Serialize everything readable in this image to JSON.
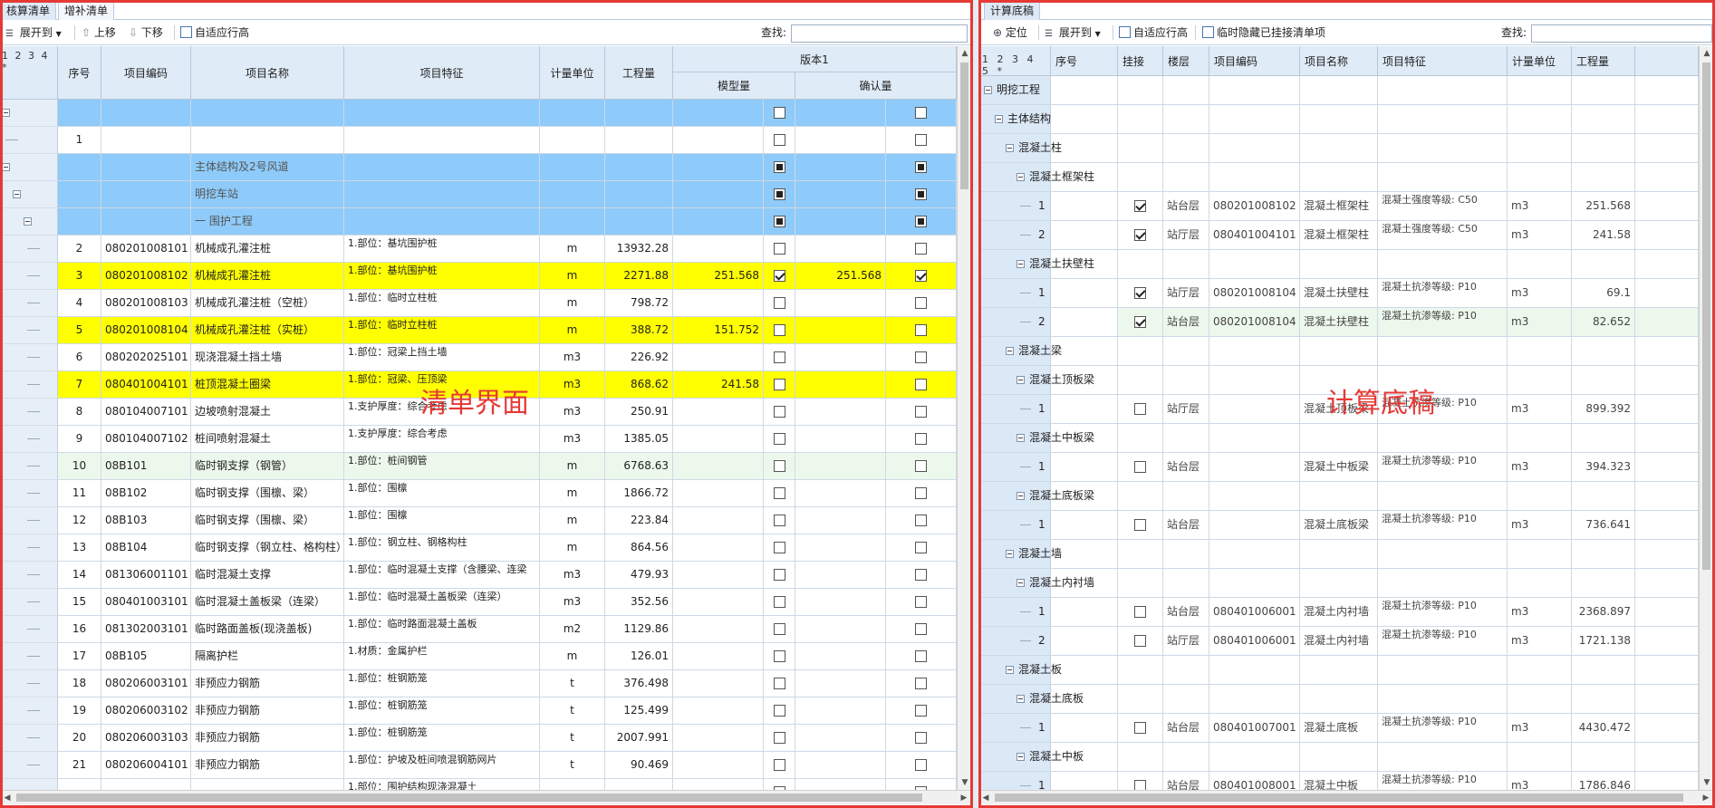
{
  "colors": {
    "accent_blue": "#8ecbfa",
    "highlight_yellow": "#ffff00",
    "pale_green": "#edf8ed",
    "frame_red": "#e53935"
  },
  "left": {
    "tabs": [
      "核算清单",
      "增补清单"
    ],
    "toolbar": {
      "expand_label": "展开到",
      "up_label": "上移",
      "down_label": "下移",
      "auto_height_label": "自适应行高",
      "search_label": "查找:"
    },
    "levels": "1 2 3 4 *",
    "headers": {
      "seq": "序号",
      "code": "项目编码",
      "name": "项目名称",
      "feature": "项目特征",
      "unit": "计量单位",
      "qty": "工程量",
      "version": "版本1",
      "model_qty": "模型量",
      "confirm_qty": "确认量"
    },
    "overlay": "清单界面",
    "rows": [
      {
        "seq": "",
        "code": "",
        "name": "",
        "feature": "",
        "unit": "",
        "qty": "",
        "model": "",
        "c1": "off",
        "confirm": "",
        "c2": "off",
        "style": "blue"
      },
      {
        "seq": "1",
        "code": "",
        "name": "",
        "feature": "",
        "unit": "",
        "qty": "",
        "model": "",
        "c1": "off",
        "confirm": "",
        "c2": "off",
        "style": "white"
      },
      {
        "seq": "",
        "code": "",
        "name": "主体结构及2号风道",
        "feature": "",
        "unit": "",
        "qty": "",
        "model": "",
        "c1": "part",
        "confirm": "",
        "c2": "part",
        "style": "blue"
      },
      {
        "seq": "",
        "code": "",
        "name": "明挖车站",
        "feature": "",
        "unit": "",
        "qty": "",
        "model": "",
        "c1": "part",
        "confirm": "",
        "c2": "part",
        "style": "blue"
      },
      {
        "seq": "",
        "code": "",
        "name": "一 围护工程",
        "feature": "",
        "unit": "",
        "qty": "",
        "model": "",
        "c1": "part",
        "confirm": "",
        "c2": "part",
        "style": "blue"
      },
      {
        "seq": "2",
        "code": "080201008101",
        "name": "机械成孔灌注桩",
        "feature": "1.部位：基坑围护桩",
        "unit": "m",
        "qty": "13932.28",
        "model": "",
        "c1": "off",
        "confirm": "",
        "c2": "off",
        "style": "white"
      },
      {
        "seq": "3",
        "code": "080201008102",
        "name": "机械成孔灌注桩",
        "feature": "1.部位：基坑围护桩",
        "unit": "m",
        "qty": "2271.88",
        "model": "251.568",
        "c1": "on",
        "confirm": "251.568",
        "c2": "on",
        "style": "yellow"
      },
      {
        "seq": "4",
        "code": "080201008103",
        "name": "机械成孔灌注桩（空桩）",
        "feature": "1.部位：临时立柱桩",
        "unit": "m",
        "qty": "798.72",
        "model": "",
        "c1": "off",
        "confirm": "",
        "c2": "off",
        "style": "white"
      },
      {
        "seq": "5",
        "code": "080201008104",
        "name": "机械成孔灌注桩（实桩）",
        "feature": "1.部位：临时立柱桩",
        "unit": "m",
        "qty": "388.72",
        "model": "151.752",
        "c1": "off",
        "confirm": "",
        "c2": "off",
        "style": "yellow"
      },
      {
        "seq": "6",
        "code": "080202025101",
        "name": "现浇混凝土挡土墙",
        "feature": "1.部位：冠梁上挡土墙",
        "unit": "m3",
        "qty": "226.92",
        "model": "",
        "c1": "off",
        "confirm": "",
        "c2": "off",
        "style": "white"
      },
      {
        "seq": "7",
        "code": "080401004101",
        "name": "桩顶混凝土圈梁",
        "feature": "1.部位：冠梁、压顶梁",
        "unit": "m3",
        "qty": "868.62",
        "model": "241.58",
        "c1": "off",
        "confirm": "",
        "c2": "off",
        "style": "yellow"
      },
      {
        "seq": "8",
        "code": "080104007101",
        "name": "边坡喷射混凝土",
        "feature": "1.支护厚度：综合考虑",
        "unit": "m3",
        "qty": "250.91",
        "model": "",
        "c1": "off",
        "confirm": "",
        "c2": "off",
        "style": "white"
      },
      {
        "seq": "9",
        "code": "080104007102",
        "name": "桩间喷射混凝土",
        "feature": "1.支护厚度：综合考虑",
        "unit": "m3",
        "qty": "1385.05",
        "model": "",
        "c1": "off",
        "confirm": "",
        "c2": "off",
        "style": "white"
      },
      {
        "seq": "10",
        "code": "08B101",
        "name": "临时钢支撑（钢管）",
        "feature": "1.部位：桩间钢管",
        "unit": "m",
        "qty": "6768.63",
        "model": "",
        "c1": "off",
        "confirm": "",
        "c2": "off",
        "style": "green"
      },
      {
        "seq": "11",
        "code": "08B102",
        "name": "临时钢支撑（围檩、梁）",
        "feature": "1.部位：围檩",
        "unit": "m",
        "qty": "1866.72",
        "model": "",
        "c1": "off",
        "confirm": "",
        "c2": "off",
        "style": "white"
      },
      {
        "seq": "12",
        "code": "08B103",
        "name": "临时钢支撑（围檩、梁）",
        "feature": "1.部位：围檩",
        "unit": "m",
        "qty": "223.84",
        "model": "",
        "c1": "off",
        "confirm": "",
        "c2": "off",
        "style": "white"
      },
      {
        "seq": "13",
        "code": "08B104",
        "name": "临时钢支撑（钢立柱、格构柱）",
        "feature": "1.部位：钢立柱、钢格构柱",
        "unit": "m",
        "qty": "864.56",
        "model": "",
        "c1": "off",
        "confirm": "",
        "c2": "off",
        "style": "white"
      },
      {
        "seq": "14",
        "code": "081306001101",
        "name": "临时混凝土支撑",
        "feature": "1.部位：临时混凝土支撑（含腰梁、连梁",
        "unit": "m3",
        "qty": "479.93",
        "model": "",
        "c1": "off",
        "confirm": "",
        "c2": "off",
        "style": "white"
      },
      {
        "seq": "15",
        "code": "080401003101",
        "name": "临时混凝土盖板梁（连梁）",
        "feature": "1.部位：临时混凝土盖板梁（连梁）",
        "unit": "m3",
        "qty": "352.56",
        "model": "",
        "c1": "off",
        "confirm": "",
        "c2": "off",
        "style": "white"
      },
      {
        "seq": "16",
        "code": "081302003101",
        "name": "临时路面盖板(现浇盖板)",
        "feature": "1.部位：临时路面混凝土盖板",
        "unit": "m2",
        "qty": "1129.86",
        "model": "",
        "c1": "off",
        "confirm": "",
        "c2": "off",
        "style": "white"
      },
      {
        "seq": "17",
        "code": "08B105",
        "name": "隔离护栏",
        "feature": "1.材质：金属护栏",
        "unit": "m",
        "qty": "126.01",
        "model": "",
        "c1": "off",
        "confirm": "",
        "c2": "off",
        "style": "white"
      },
      {
        "seq": "18",
        "code": "080206003101",
        "name": "非预应力钢筋",
        "feature": "1.部位：桩钢筋笼",
        "unit": "t",
        "qty": "376.498",
        "model": "",
        "c1": "off",
        "confirm": "",
        "c2": "off",
        "style": "white"
      },
      {
        "seq": "19",
        "code": "080206003102",
        "name": "非预应力钢筋",
        "feature": "1.部位：桩钢筋笼",
        "unit": "t",
        "qty": "125.499",
        "model": "",
        "c1": "off",
        "confirm": "",
        "c2": "off",
        "style": "white"
      },
      {
        "seq": "20",
        "code": "080206003103",
        "name": "非预应力钢筋",
        "feature": "1.部位：桩钢筋笼",
        "unit": "t",
        "qty": "2007.991",
        "model": "",
        "c1": "off",
        "confirm": "",
        "c2": "off",
        "style": "white"
      },
      {
        "seq": "21",
        "code": "080206004101",
        "name": "非预应力钢筋",
        "feature": "1.部位：护坡及桩间喷混钢筋网片",
        "unit": "t",
        "qty": "90.469",
        "model": "",
        "c1": "off",
        "confirm": "",
        "c2": "off",
        "style": "white"
      },
      {
        "seq": "",
        "code": "",
        "name": "",
        "feature": "1.部位：围护结构现浇混凝土",
        "unit": "",
        "qty": "",
        "model": "",
        "c1": "off",
        "confirm": "",
        "c2": "off",
        "style": "white"
      }
    ]
  },
  "right": {
    "tabs": [
      "计算底稿"
    ],
    "toolbar": {
      "locate_label": "定位",
      "expand_label": "展开到",
      "auto_height_label": "自适应行高",
      "hide_label": "临时隐藏已挂接清单项",
      "search_label": "查找:"
    },
    "levels": "1 2 3 4 5 *",
    "headers": {
      "seq": "序号",
      "attach": "挂接",
      "floor": "楼层",
      "code": "项目编码",
      "name": "项目名称",
      "feature": "项目特征",
      "unit": "计量单位",
      "qty": "工程量"
    },
    "overlay": "计算底稿",
    "rows": [
      {
        "type": "group",
        "depth": 0,
        "label": "明挖工程"
      },
      {
        "type": "group",
        "depth": 1,
        "label": "主体结构"
      },
      {
        "type": "group",
        "depth": 2,
        "label": "混凝土柱"
      },
      {
        "type": "group",
        "depth": 3,
        "label": "混凝土框架柱"
      },
      {
        "type": "item",
        "depth": 4,
        "seq": "1",
        "chk": "on",
        "floor": "站台层",
        "code": "080201008102",
        "name": "混凝土框架柱",
        "feature": "混凝土强度等级: C50",
        "unit": "m3",
        "qty": "251.568",
        "style": "white"
      },
      {
        "type": "item",
        "depth": 4,
        "seq": "2",
        "chk": "on",
        "floor": "站厅层",
        "code": "080401004101",
        "name": "混凝土框架柱",
        "feature": "混凝土强度等级: C50",
        "unit": "m3",
        "qty": "241.58",
        "style": "white"
      },
      {
        "type": "group",
        "depth": 3,
        "label": "混凝土扶壁柱"
      },
      {
        "type": "item",
        "depth": 4,
        "seq": "1",
        "chk": "on",
        "floor": "站厅层",
        "code": "080201008104",
        "name": "混凝土扶壁柱",
        "feature": "混凝土抗渗等级: P10",
        "unit": "m3",
        "qty": "69.1",
        "style": "white"
      },
      {
        "type": "item",
        "depth": 4,
        "seq": "2",
        "chk": "on",
        "floor": "站台层",
        "code": "080201008104",
        "name": "混凝土扶壁柱",
        "feature": "混凝土抗渗等级: P10",
        "unit": "m3",
        "qty": "82.652",
        "style": "green"
      },
      {
        "type": "group",
        "depth": 2,
        "label": "混凝土梁"
      },
      {
        "type": "group",
        "depth": 3,
        "label": "混凝土顶板梁"
      },
      {
        "type": "item",
        "depth": 4,
        "seq": "1",
        "chk": "off",
        "floor": "站厅层",
        "code": "",
        "name": "混凝土顶板梁",
        "feature": "混凝土抗渗等级: P10",
        "unit": "m3",
        "qty": "899.392",
        "style": "white"
      },
      {
        "type": "group",
        "depth": 3,
        "label": "混凝土中板梁"
      },
      {
        "type": "item",
        "depth": 4,
        "seq": "1",
        "chk": "off",
        "floor": "站台层",
        "code": "",
        "name": "混凝土中板梁",
        "feature": "混凝土抗渗等级: P10",
        "unit": "m3",
        "qty": "394.323",
        "style": "white"
      },
      {
        "type": "group",
        "depth": 3,
        "label": "混凝土底板梁"
      },
      {
        "type": "item",
        "depth": 4,
        "seq": "1",
        "chk": "off",
        "floor": "站台层",
        "code": "",
        "name": "混凝土底板梁",
        "feature": "混凝土抗渗等级: P10",
        "unit": "m3",
        "qty": "736.641",
        "style": "white"
      },
      {
        "type": "group",
        "depth": 2,
        "label": "混凝土墙"
      },
      {
        "type": "group",
        "depth": 3,
        "label": "混凝土内衬墙"
      },
      {
        "type": "item",
        "depth": 4,
        "seq": "1",
        "chk": "off",
        "floor": "站台层",
        "code": "080401006001",
        "name": "混凝土内衬墙",
        "feature": "混凝土抗渗等级: P10",
        "unit": "m3",
        "qty": "2368.897",
        "style": "white"
      },
      {
        "type": "item",
        "depth": 4,
        "seq": "2",
        "chk": "off",
        "floor": "站厅层",
        "code": "080401006001",
        "name": "混凝土内衬墙",
        "feature": "混凝土抗渗等级: P10",
        "unit": "m3",
        "qty": "1721.138",
        "style": "white"
      },
      {
        "type": "group",
        "depth": 2,
        "label": "混凝土板"
      },
      {
        "type": "group",
        "depth": 3,
        "label": "混凝土底板"
      },
      {
        "type": "item",
        "depth": 4,
        "seq": "1",
        "chk": "off",
        "floor": "站台层",
        "code": "080401007001",
        "name": "混凝土底板",
        "feature": "混凝土抗渗等级: P10",
        "unit": "m3",
        "qty": "4430.472",
        "style": "white"
      },
      {
        "type": "group",
        "depth": 3,
        "label": "混凝土中板"
      },
      {
        "type": "item",
        "depth": 4,
        "seq": "1",
        "chk": "off",
        "floor": "站台层",
        "code": "080401008001",
        "name": "混凝土中板",
        "feature": "混凝土抗渗等级: P10",
        "unit": "m3",
        "qty": "1786.846",
        "style": "white"
      }
    ]
  }
}
